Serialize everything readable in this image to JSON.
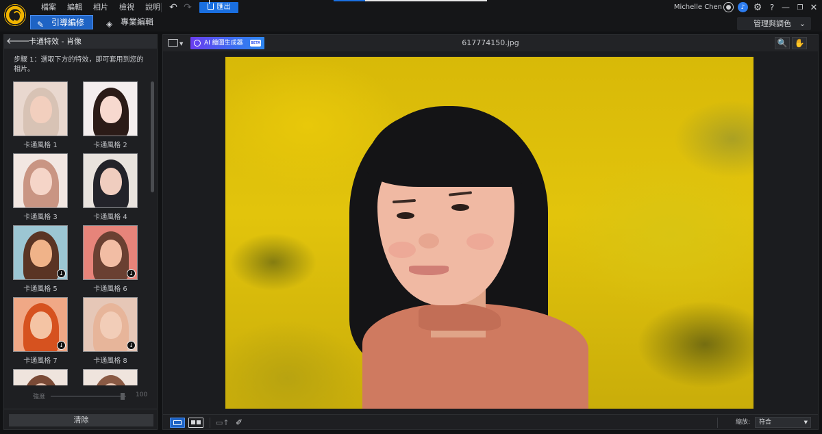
{
  "menu": [
    "檔案",
    "編輯",
    "相片",
    "檢視",
    "說明"
  ],
  "toolbar": {
    "export_label": "匯出"
  },
  "user": {
    "name": "Michelle Chen"
  },
  "modes": {
    "guided": "引導編修",
    "pro": "專業編輯"
  },
  "manage_label": "管理與調色",
  "panel": {
    "title": "卡通特效 - 肖像",
    "step": "步驟 1：選取下方的特效，即可套用到您的相片。",
    "thumbnails": [
      {
        "label": "卡通風格 1",
        "download": false,
        "bg": "#e9d8cf",
        "hair": "#d8c3b5",
        "skin": "#f2cfbe"
      },
      {
        "label": "卡通風格 2",
        "download": false,
        "bg": "#f4eeee",
        "hair": "#2b1b17",
        "skin": "#f7d9cf"
      },
      {
        "label": "卡通風格 3",
        "download": false,
        "bg": "#f2e7e2",
        "hair": "#c99583",
        "skin": "#f5d5c8"
      },
      {
        "label": "卡通風格 4",
        "download": false,
        "bg": "#e9e3de",
        "hair": "#23232a",
        "skin": "#f0cdbf"
      },
      {
        "label": "卡通風格 5",
        "download": true,
        "bg": "#9cc6d3",
        "hair": "#5a3424",
        "skin": "#f0b389"
      },
      {
        "label": "卡通風格 6",
        "download": true,
        "bg": "#e7847a",
        "hair": "#6a4032",
        "skin": "#f2bda4"
      },
      {
        "label": "卡通風格 7",
        "download": true,
        "bg": "#f0a886",
        "hair": "#d6521f",
        "skin": "#f4c4a4"
      },
      {
        "label": "卡通風格 8",
        "download": true,
        "bg": "#e6c7b7",
        "hair": "#e7b59a",
        "skin": "#f2cdb8"
      },
      {
        "label": "",
        "download": false,
        "bg": "#efe4dd",
        "hair": "#7a4a36",
        "skin": "#f1cdb9"
      },
      {
        "label": "",
        "download": false,
        "bg": "#efe4dd",
        "hair": "#8a5a44",
        "skin": "#f1cdb9"
      }
    ],
    "strength_label": "強度",
    "strength_value": "100",
    "clear_label": "清除"
  },
  "main": {
    "ai_label": "AI 繪圖生成器",
    "beta": "BETA",
    "file_name": "617774150.jpg",
    "zoom_label": "縮放:",
    "zoom_value": "符合"
  },
  "colors": {
    "accent": "#1e63c4",
    "export": "#1a6fe0"
  }
}
